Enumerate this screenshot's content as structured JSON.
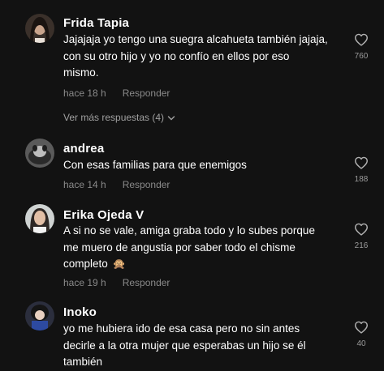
{
  "comments": [
    {
      "username": "Frida Tapia",
      "lines": [
        "Jajajaja yo tengo una suegra alcahueta también jajaja,",
        "con su otro hijo y yo no confío en ellos por eso",
        "mismo."
      ],
      "time": "hace 18 h",
      "reply_label": "Responder",
      "likes": "760",
      "more_replies": "Ver más respuestas (4)"
    },
    {
      "username": "andrea",
      "lines": [
        "Con esas familias para que enemigos"
      ],
      "time": "hace 14 h",
      "reply_label": "Responder",
      "likes": "188"
    },
    {
      "username": "Erika Ojeda V",
      "lines": [
        "A si no se vale, amiga graba todo y lo subes porque",
        "me muero de angustia por saber todo el chisme",
        "completo"
      ],
      "emoji": "🙊",
      "time": "hace 19 h",
      "reply_label": "Responder",
      "likes": "216"
    },
    {
      "username": "Inoko",
      "lines": [
        "yo me hubiera ido de esa casa pero no sin antes",
        "decirle a la otra mujer que esperabas un hijo se él",
        "también"
      ],
      "likes": "40"
    }
  ],
  "icons": {
    "like": "heart-outline-icon",
    "expand": "chevron-down-icon"
  },
  "colors": {
    "background": "#121212",
    "username": "#ffffff",
    "meta": "#8a8a8a"
  }
}
